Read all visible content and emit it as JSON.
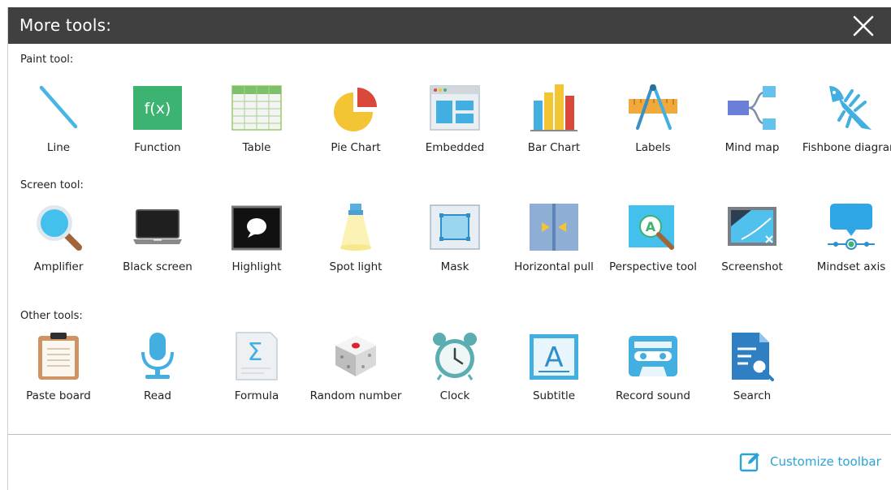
{
  "dialog": {
    "title": "More tools:",
    "close_icon": "close-icon"
  },
  "sections": {
    "paint": {
      "label": "Paint tool:",
      "tools": [
        {
          "label": "Line",
          "icon": "line-icon"
        },
        {
          "label": "Function",
          "icon": "function-icon"
        },
        {
          "label": "Table",
          "icon": "table-icon"
        },
        {
          "label": "Pie Chart",
          "icon": "pie-chart-icon"
        },
        {
          "label": "Embedded",
          "icon": "embedded-icon"
        },
        {
          "label": "Bar Chart",
          "icon": "bar-chart-icon"
        },
        {
          "label": "Labels",
          "icon": "labels-icon"
        },
        {
          "label": "Mind  map",
          "icon": "mind-map-icon"
        },
        {
          "label": "Fishbone diagram",
          "icon": "fishbone-icon"
        }
      ]
    },
    "screen": {
      "label": "Screen tool:",
      "tools": [
        {
          "label": "Amplifier",
          "icon": "magnifier-icon"
        },
        {
          "label": "Black screen",
          "icon": "black-screen-icon"
        },
        {
          "label": "Highlight",
          "icon": "highlight-icon"
        },
        {
          "label": "Spot light",
          "icon": "spotlight-icon"
        },
        {
          "label": "Mask",
          "icon": "mask-icon"
        },
        {
          "label": "Horizontal pull",
          "icon": "horizontal-pull-icon"
        },
        {
          "label": "Perspective tool",
          "icon": "perspective-icon"
        },
        {
          "label": "Screenshot",
          "icon": "screenshot-icon"
        },
        {
          "label": "Mindset axis",
          "icon": "mindset-axis-icon"
        }
      ]
    },
    "other": {
      "label": "Other tools:",
      "tools": [
        {
          "label": "Paste board",
          "icon": "clipboard-icon"
        },
        {
          "label": "Read",
          "icon": "microphone-icon"
        },
        {
          "label": "Formula",
          "icon": "formula-icon"
        },
        {
          "label": "Random number",
          "icon": "dice-icon"
        },
        {
          "label": "Clock",
          "icon": "alarm-clock-icon"
        },
        {
          "label": "Subtitle",
          "icon": "subtitle-icon"
        },
        {
          "label": "Record sound",
          "icon": "cassette-icon"
        },
        {
          "label": "Search",
          "icon": "search-document-icon"
        }
      ]
    }
  },
  "footer": {
    "customize_label": "Customize toolbar",
    "customize_icon": "edit-icon"
  },
  "colors": {
    "titlebar": "#404040",
    "accent": "#2aa3d6",
    "green": "#3cb371",
    "orange": "#e8a33a",
    "red": "#d9483b"
  }
}
